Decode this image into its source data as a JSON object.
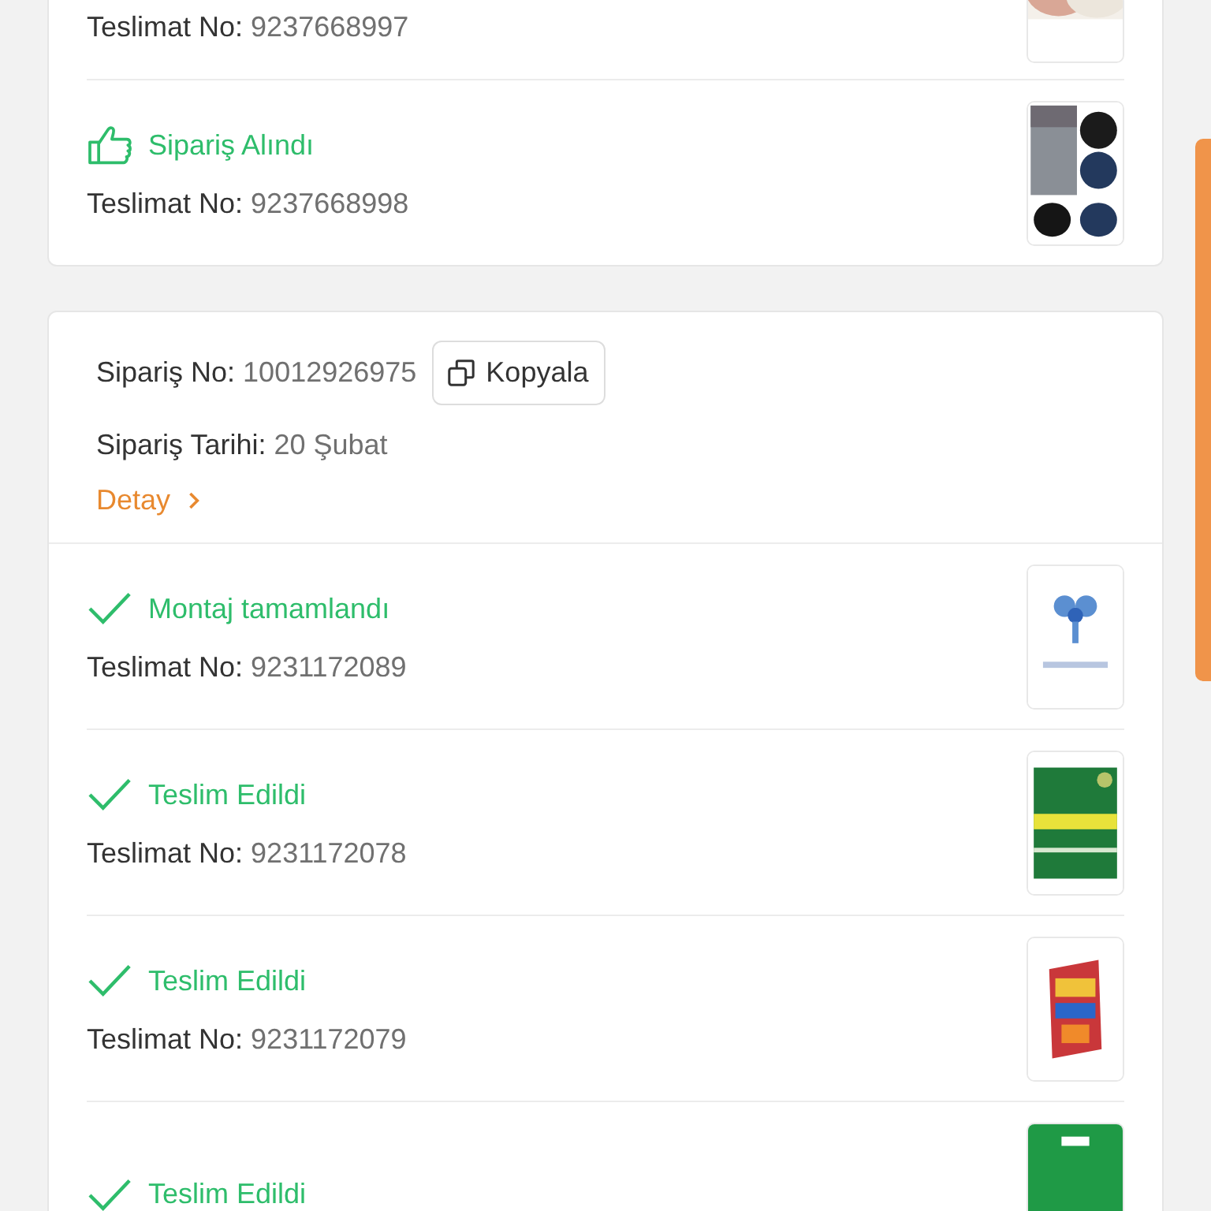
{
  "orders": [
    {
      "shipments": [
        {
          "delivery_label": "Teslimat No:",
          "delivery_no": "9237668997"
        },
        {
          "kind": "received",
          "status": "Sipariş Alındı",
          "delivery_label": "Teslimat No:",
          "delivery_no": "9237668998"
        }
      ]
    },
    {
      "order_no_label": "Sipariş No:",
      "order_no": "10012926975",
      "copy_button": "Kopyala",
      "date_label": "Sipariş Tarihi:",
      "date": "20 Şubat",
      "detail_link": "Detay",
      "shipments": [
        {
          "kind": "done",
          "status": "Montaj tamamlandı",
          "delivery_label": "Teslimat No:",
          "delivery_no": "9231172089"
        },
        {
          "kind": "done",
          "status": "Teslim Edildi",
          "delivery_label": "Teslimat No:",
          "delivery_no": "9231172078"
        },
        {
          "kind": "done",
          "status": "Teslim Edildi",
          "delivery_label": "Teslimat No:",
          "delivery_no": "9231172079"
        },
        {
          "kind": "done",
          "status": "Teslim Edildi"
        }
      ]
    }
  ]
}
